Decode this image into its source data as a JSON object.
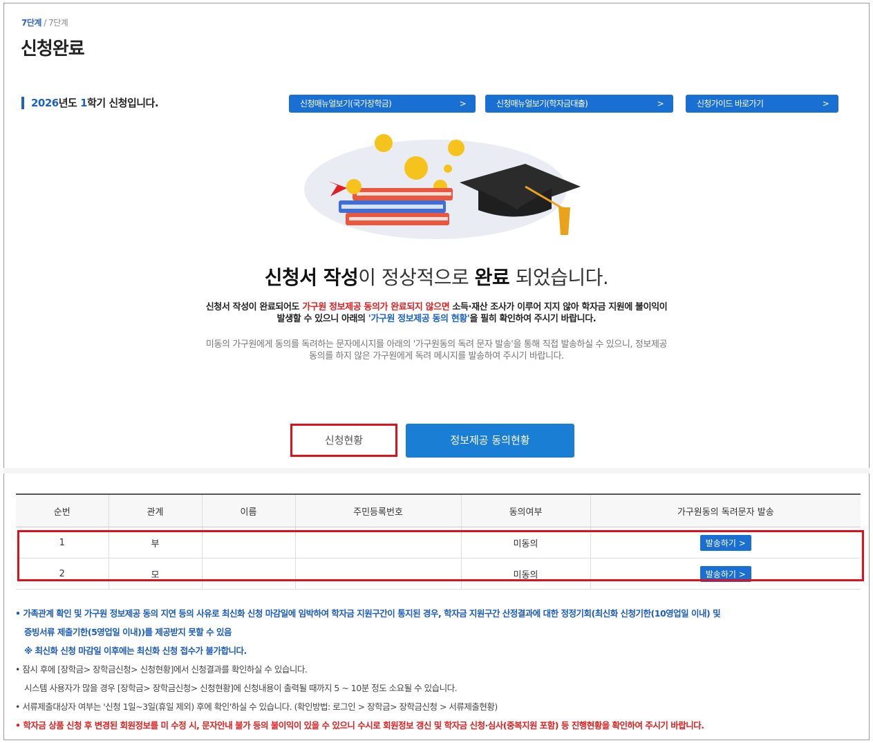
{
  "breadcrumb": {
    "current": "7단계",
    "separator": " / ",
    "total": "7단계"
  },
  "page_title": "신청완료",
  "semester": {
    "year": "2026",
    "year_suffix": "년도 ",
    "term": "1",
    "term_suffix": "학기 신청입니다."
  },
  "top_buttons": [
    {
      "label": "신청매뉴얼보기(국가장학금)",
      "arrow": ">"
    },
    {
      "label": "신청매뉴얼보기(학자금대출)",
      "arrow": ">"
    },
    {
      "label": "신청가이드 바로가기",
      "arrow": ">"
    }
  ],
  "message": {
    "main_a": "신청서 작성",
    "main_b": "이 정상적으로 ",
    "main_c": "완료",
    "main_d": " 되었습니다.",
    "sub_1a": "신청서 작성이 완료되어도 ",
    "sub_1b": "가구원 정보제공 동의가 완료되지 않으면",
    "sub_1c": " 소득·재산 조사가 이루어 지지 않아 학자금 지원에 불이익이",
    "sub_2a": "발생할 수 있으니 아래의 ",
    "sub_2b": "'가구원 정보제공 동의 현황'",
    "sub_2c": "을 필히 확인하여 주시기 바랍니다.",
    "sub_3": "미동의 가구원에게 동의를 독려하는 문자메시지를 아래의 '가구원동의 독려 문자 발송'을 통해 직접 발송하실 수 있으니, 정보제공",
    "sub_4": "동의를 하지 않은 가구원에게 독려 메시지를 발송하여 주시기 바랍니다."
  },
  "buttons": {
    "status": "신청현황",
    "consent": "정보제공 동의현황"
  },
  "table": {
    "headers": [
      "순번",
      "관계",
      "이름",
      "주민등록번호",
      "동의여부",
      "가구원동의 독려문자 발송"
    ],
    "rows": [
      {
        "no": "1",
        "relation": "부",
        "name": "",
        "rrn": "",
        "consent": "미동의",
        "action": "발송하기 >"
      },
      {
        "no": "2",
        "relation": "모",
        "name": "",
        "rrn": "",
        "consent": "미동의",
        "action": "발송하기 >"
      }
    ]
  },
  "notes": {
    "n1a": "• 가족관계 확인 및 가구원 정보제공 동의 지연 등의 사유로 최신화 신청 마감일에 임박하여 학자금 지원구간이 통지된 경우, 학자금 지원구간 산정결과에 대한 정정기회(최신화 신청기한(10영업일 이내) 및",
    "n1b": "증빙서류 제출기한(5영업일 이내))를 제공받지 못할 수 있음",
    "n1c": "※ 최신화 신청 마감일 이후에는 최신화 신청 접수가 불가합니다.",
    "n2a": "• 잠시 후에 [장학금> 장학금신청> 신청현황]에서 신청결과를 확인하실 수 있습니다.",
    "n2b": "시스템 사용자가 많을 경우 [장학금> 장학금신청> 신청현황]에 신청내용이 출력될 때까지 5 ~ 10분 정도 소요될 수 있습니다.",
    "n3": "• 서류제출대상자 여부는 '신청 1일~3일(휴일 제외) 후에 확인'하실 수 있습니다. (확인방법: 로그인 > 장학금> 장학금신청 > 서류제출현황)",
    "n4": "• 학자금 상품 신청 후 변경된 회원정보를 미 수정 시, 문자안내 불가 등의 불이익이 있을 수 있으니 수시로 회원정보 갱신 및 학자금 신청·심사(중복지원 포함) 등 진행현황을 확인하여 주시기 바랍니다."
  },
  "colors": {
    "accent_blue": "#1a6fd2",
    "highlight_red": "#e0101a",
    "text_red": "#e02020"
  }
}
